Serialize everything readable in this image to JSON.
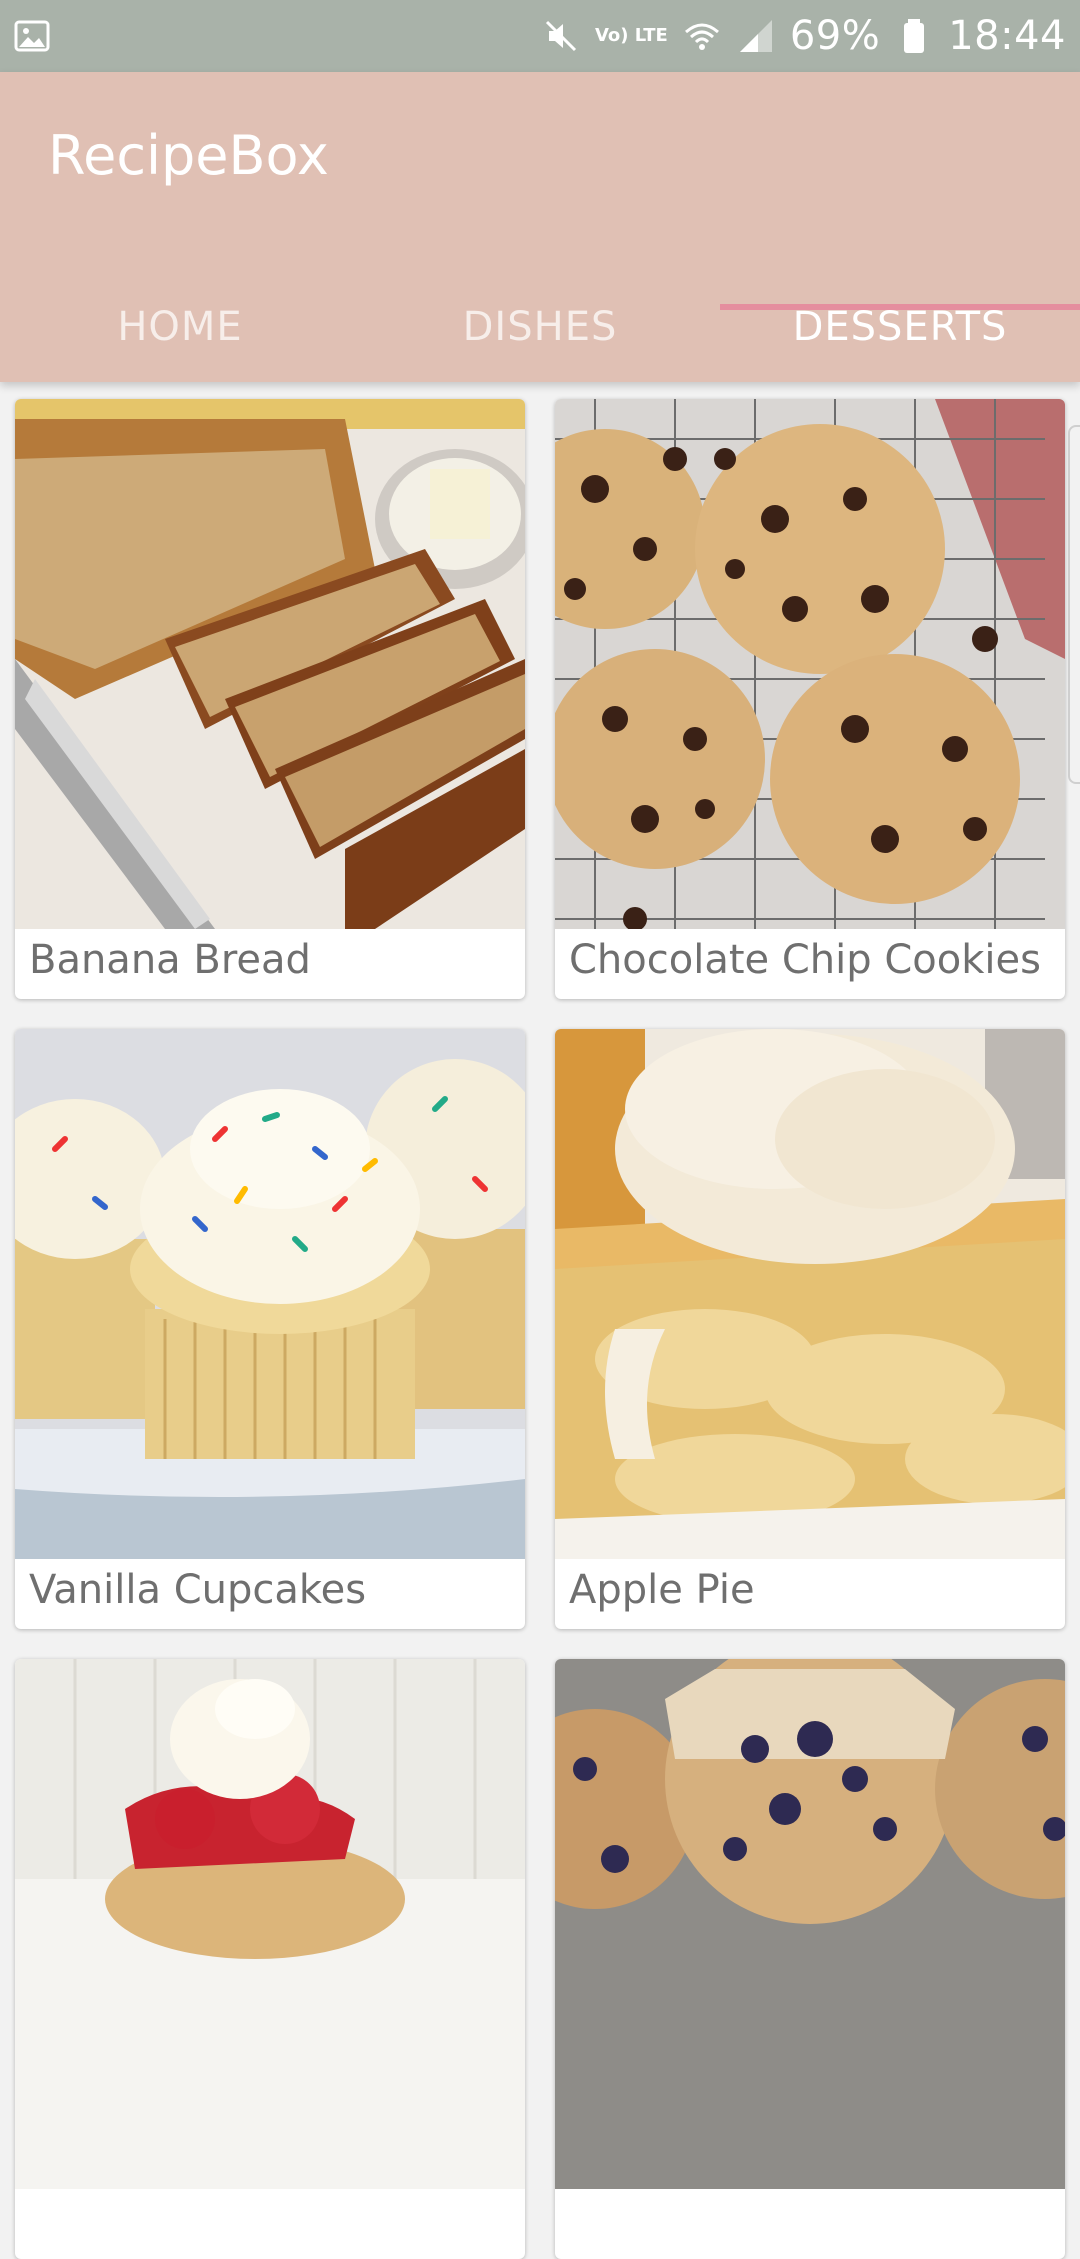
{
  "status_bar": {
    "time": "18:44",
    "battery_pct": "69%",
    "network_label": "Vo) LTE",
    "icons": [
      "gallery-icon",
      "mute-icon",
      "volte-icon",
      "wifi-icon",
      "signal-icon",
      "battery-icon"
    ]
  },
  "app": {
    "title": "RecipeBox",
    "tabs": [
      {
        "label": "HOME",
        "active": false
      },
      {
        "label": "DISHES",
        "active": false
      },
      {
        "label": "DESSERTS",
        "active": true
      }
    ],
    "accent_color": "#e58e9e",
    "appbar_color": "#e0c0b4"
  },
  "recipes": [
    {
      "title": "Banana Bread"
    },
    {
      "title": "Chocolate Chip Cookies"
    },
    {
      "title": "Vanilla Cupcakes"
    },
    {
      "title": "Apple Pie"
    },
    {
      "title": ""
    },
    {
      "title": ""
    }
  ]
}
